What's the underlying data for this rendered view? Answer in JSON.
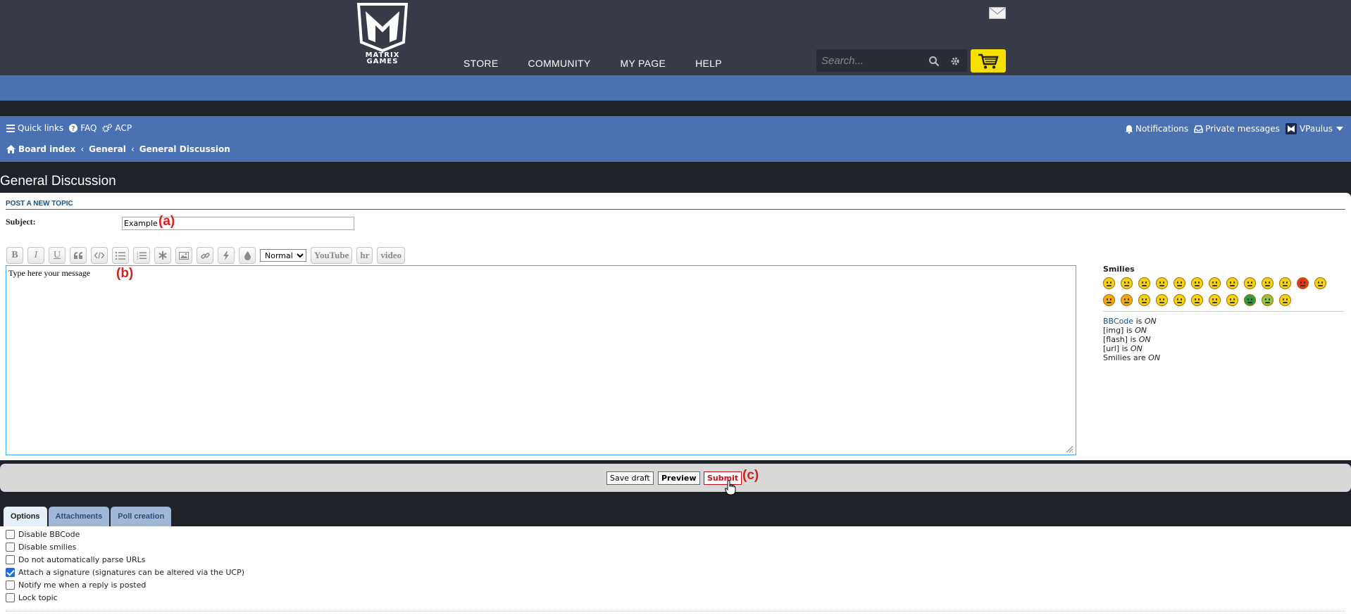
{
  "site": {
    "logo_text_line1": "MATRIX",
    "logo_text_line2": "GAMES",
    "nav": [
      "STORE",
      "COMMUNITY",
      "MY PAGE",
      "HELP"
    ],
    "search_placeholder": "Search..."
  },
  "forum_nav": {
    "quick_links": "Quick links",
    "faq": "FAQ",
    "acp": "ACP",
    "notifications": "Notifications",
    "private_messages": "Private messages",
    "username": "VPaulus",
    "breadcrumb": [
      "Board index",
      "General",
      "General Discussion"
    ]
  },
  "page": {
    "title": "General Discussion",
    "post_heading": "POST A NEW TOPIC",
    "subject_label": "Subject:",
    "subject_value": "Example",
    "message_value": "Type here your message",
    "callout_a": "(a)",
    "callout_b": "(b)",
    "callout_c": "(c)"
  },
  "toolbar": {
    "buttons": [
      "B",
      "I",
      "U",
      "quote",
      "code",
      "list",
      "list-numbered",
      "list-item",
      "image",
      "link",
      "flash",
      "color"
    ],
    "font_size_selected": "Normal",
    "custom": [
      "YouTube",
      "hr",
      "video"
    ]
  },
  "sidebar": {
    "smilies_title": "Smilies",
    "bbcode_link": "BBCode",
    "bbcode_status": "is",
    "on": "ON",
    "img": "[img] is",
    "flash": "[flash] is",
    "url": "[url] is",
    "smilies_are": "Smilies are"
  },
  "smiley_colors": [
    "#f7d30d",
    "#f7d30d",
    "#f7d30d",
    "#f7d30d",
    "#f7d30d",
    "#f7d30d",
    "#f7d30d",
    "#f7d30d",
    "#f7d30d",
    "#f7d30d",
    "#f7d30d",
    "#e8351e",
    "#f7d30d",
    "#f7a80d",
    "#f7a80d",
    "#f7d30d",
    "#f7d30d",
    "#f7d30d",
    "#f7d30d",
    "#f7d30d",
    "#f7d30d",
    "#2c9a44",
    "#8dc63f",
    "#f7d30d"
  ],
  "submit_bar": {
    "save_draft": "Save draft",
    "preview": "Preview",
    "submit": "Submit"
  },
  "tabs": [
    "Options",
    "Attachments",
    "Poll creation"
  ],
  "options": [
    {
      "label": "Disable BBCode",
      "checked": false
    },
    {
      "label": "Disable smilies",
      "checked": false
    },
    {
      "label": "Do not automatically parse URLs",
      "checked": false
    },
    {
      "label": "Attach a signature (signatures can be altered via the UCP)",
      "checked": true
    },
    {
      "label": "Notify me when a reply is posted",
      "checked": false
    },
    {
      "label": "Lock topic",
      "checked": false
    }
  ],
  "colors": {
    "header_bg": "#363b47",
    "forum_blue": "#4a72b3",
    "page_bg": "#1f2228",
    "cart_yellow": "#f5e000",
    "callout_red": "#d6201e",
    "submit_red": "#c8101e"
  }
}
